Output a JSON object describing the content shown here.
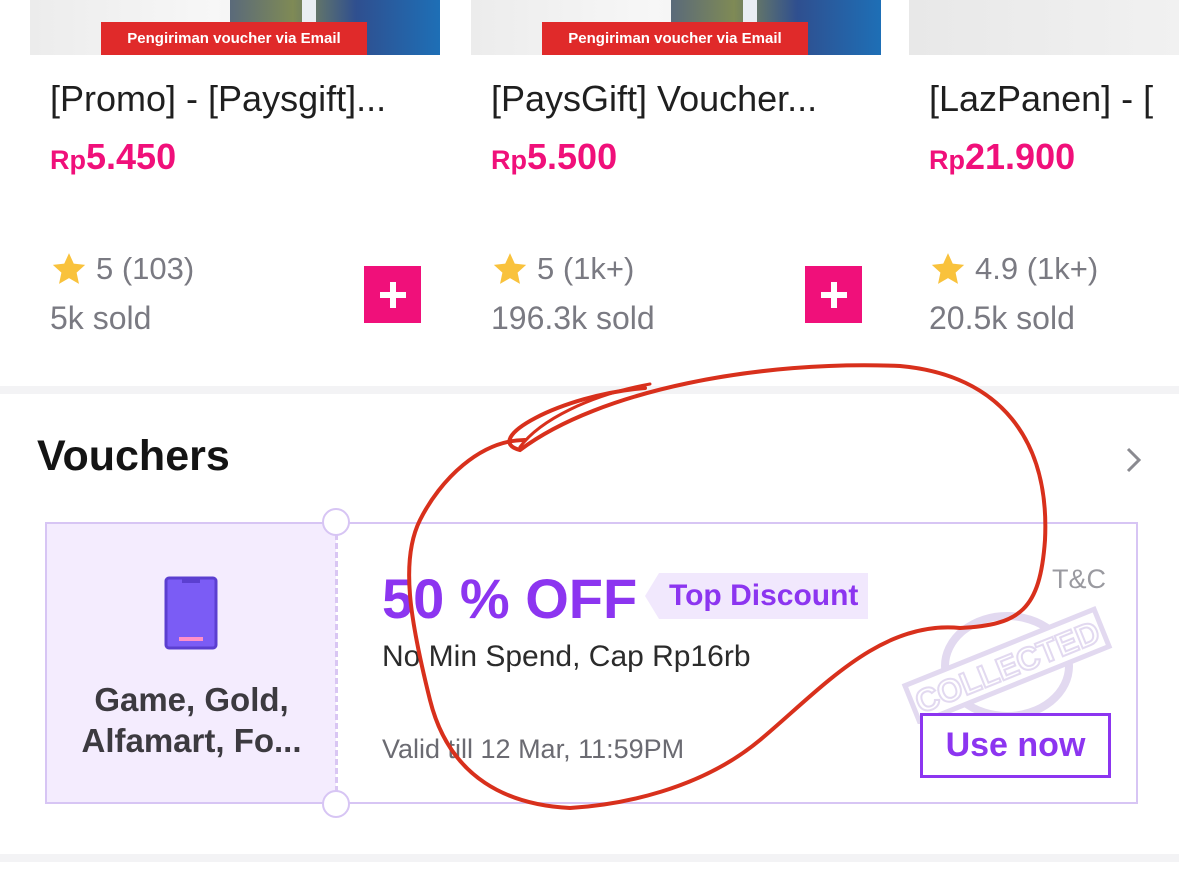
{
  "products": [
    {
      "banner": "Pengiriman voucher via Email",
      "title": "[Promo] - [Paysgift]...",
      "price_currency": "Rp",
      "price_amount": "5.450",
      "rating": "5 (103)",
      "sold": "5k sold",
      "star_icon": "star-icon",
      "add_icon": "plus-icon"
    },
    {
      "banner": "Pengiriman voucher via Email",
      "title": "[PaysGift] Voucher...",
      "price_currency": "Rp",
      "price_amount": "5.500",
      "rating": "5 (1k+)",
      "sold": "196.3k sold",
      "star_icon": "star-icon",
      "add_icon": "plus-icon"
    },
    {
      "banner": "",
      "title": "[LazPanen] - [",
      "price_currency": "Rp",
      "price_amount": "21.900",
      "rating": "4.9 (1k+)",
      "sold": "20.5k sold",
      "star_icon": "star-icon"
    }
  ],
  "vouchers": {
    "title": "Vouchers",
    "more_icon": "chevron-right-icon",
    "card": {
      "category_icon": "phone-icon",
      "category": "Game, Gold, Alfamart, Fo...",
      "discount": "50 % OFF",
      "tag": "Top Discount",
      "description": "No Min Spend, Cap Rp16rb",
      "validity": "Valid till 12 Mar, 11:59PM",
      "tnc": "T&C",
      "stamp": "COLLECTED",
      "action": "Use now"
    }
  },
  "colors": {
    "price": "#f0107a",
    "accent": "#8c35f0",
    "add_button": "#f0107a",
    "annotation": "#d8301c"
  }
}
